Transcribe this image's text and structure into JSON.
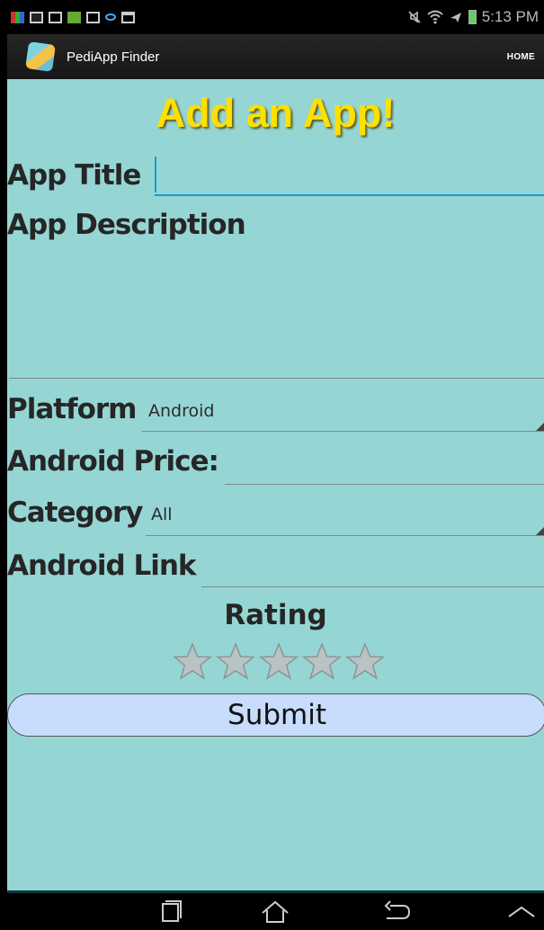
{
  "status_bar": {
    "time": "5:13 PM",
    "left_icons": [
      "multi-app-icon",
      "mail-icon",
      "gmail-icon",
      "app-icon",
      "upload-icon",
      "eye-icon",
      "clipboard-icon"
    ],
    "right_icons": [
      "mute-icon",
      "wifi-icon",
      "airplane-icon",
      "battery-icon"
    ]
  },
  "action_bar": {
    "app_name": "PediApp Finder",
    "home_label": "HOME"
  },
  "form": {
    "page_title": "Add an App!",
    "app_title_label": "App Title",
    "app_title_value": "",
    "app_description_label": "App Description",
    "app_description_value": "",
    "platform_label": "Platform",
    "platform_value": "Android",
    "android_price_label": "Android Price:",
    "android_price_value": "",
    "category_label": "Category",
    "category_value": "All",
    "android_link_label": "Android Link",
    "android_link_value": "",
    "rating_label": "Rating",
    "rating_value": 0,
    "rating_max": 5,
    "submit_label": "Submit"
  },
  "colors": {
    "background": "#95d6d4",
    "title": "#fde000",
    "submit_bg": "#c8dcfb",
    "focus": "#1a9bd0"
  },
  "nav_bar": {
    "buttons": [
      "recent-apps-icon",
      "home-icon",
      "back-icon",
      "menu-up-icon"
    ]
  }
}
